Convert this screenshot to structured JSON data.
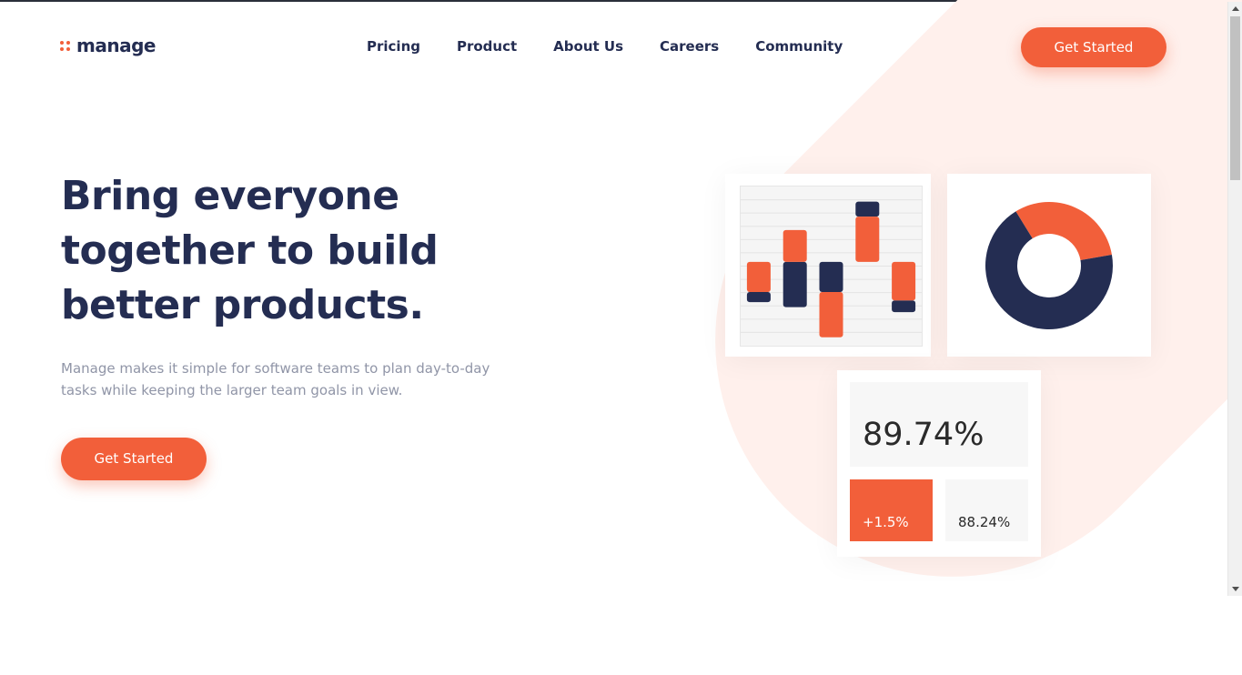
{
  "brand": {
    "name": "manage"
  },
  "nav": {
    "items": [
      {
        "label": "Pricing"
      },
      {
        "label": "Product"
      },
      {
        "label": "About Us"
      },
      {
        "label": "Careers"
      },
      {
        "label": "Community"
      }
    ]
  },
  "header": {
    "cta_label": "Get Started"
  },
  "hero": {
    "title": "Bring everyone together to build better products.",
    "subtitle": "Manage makes it simple for software teams to plan day-to-day tasks while keeping the larger team goals in view.",
    "cta_label": "Get Started"
  },
  "stats": {
    "main": "89.74%",
    "change": "+1.5%",
    "secondary": "88.24%"
  },
  "colors": {
    "accent": "#f25f3a",
    "navy": "#242d52",
    "peach": "#fff0ec",
    "muted_text": "#9095a7"
  },
  "chart_data": [
    {
      "type": "bar",
      "stacked": true,
      "baseline": 0,
      "ylim": [
        -5,
        4.5
      ],
      "categories": [
        "",
        "",
        "",
        "",
        ""
      ],
      "series": [
        {
          "color": "#f25f3a",
          "values": [
            [
              0,
              -1.8
            ],
            [
              0,
              1.9
            ],
            [
              -1.8,
              -4.5
            ],
            [
              0,
              2.7
            ],
            [
              0,
              -2.3
            ]
          ]
        },
        {
          "color": "#242d52",
          "values": [
            [
              -1.8,
              -2.4
            ],
            [
              0,
              -2.7
            ],
            [
              0,
              -1.8
            ],
            [
              2.7,
              3.6
            ],
            [
              -2.3,
              -3
            ]
          ]
        }
      ]
    },
    {
      "type": "pie",
      "donut": true,
      "values": [
        31,
        69
      ],
      "colors": [
        "#f25f3a",
        "#242d52"
      ]
    }
  ]
}
